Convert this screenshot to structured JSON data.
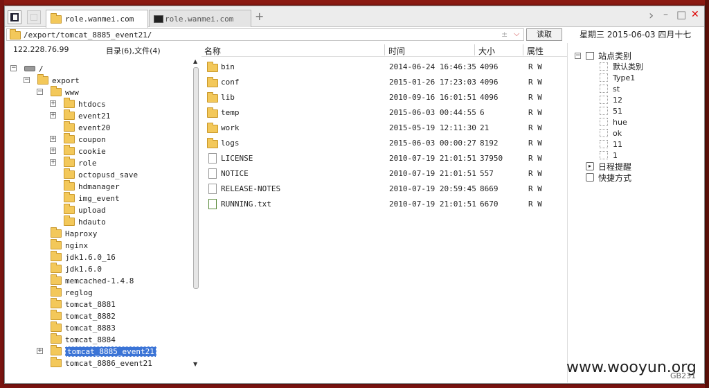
{
  "tabs": [
    {
      "label": "role.wanmei.com",
      "active": true
    },
    {
      "label": "role.wanmei.com",
      "active": false
    }
  ],
  "new_tab_label": "+",
  "window_controls": [
    "›",
    "–",
    "□",
    "✕"
  ],
  "address": {
    "path": "/export/tomcat_8885_event21/",
    "read_button": "读取"
  },
  "date_line": "星期三 2015-06-03 四月十七",
  "left_info": {
    "host": "122.228.76.99",
    "summary": "目录(6),文件(4)"
  },
  "tree": [
    {
      "label": "/",
      "level": 0,
      "exp": "-",
      "type": "drive"
    },
    {
      "label": "export",
      "level": 1,
      "exp": "-",
      "type": "folder"
    },
    {
      "label": "www",
      "level": 2,
      "exp": "-",
      "type": "folder"
    },
    {
      "label": "htdocs",
      "level": 3,
      "exp": "+",
      "type": "folder"
    },
    {
      "label": "event21",
      "level": 3,
      "exp": "+",
      "type": "folder"
    },
    {
      "label": "event20",
      "level": 3,
      "exp": "",
      "type": "folder"
    },
    {
      "label": "coupon",
      "level": 3,
      "exp": "+",
      "type": "folder"
    },
    {
      "label": "cookie",
      "level": 3,
      "exp": "+",
      "type": "folder"
    },
    {
      "label": "role",
      "level": 3,
      "exp": "+",
      "type": "folder"
    },
    {
      "label": "octopusd_save",
      "level": 3,
      "exp": "",
      "type": "folder"
    },
    {
      "label": "hdmanager",
      "level": 3,
      "exp": "",
      "type": "folder"
    },
    {
      "label": "img_event",
      "level": 3,
      "exp": "",
      "type": "folder"
    },
    {
      "label": "upload",
      "level": 3,
      "exp": "",
      "type": "folder"
    },
    {
      "label": "hdauto",
      "level": 3,
      "exp": "",
      "type": "folder"
    },
    {
      "label": "Haproxy",
      "level": 2,
      "exp": "",
      "type": "folder"
    },
    {
      "label": "nginx",
      "level": 2,
      "exp": "",
      "type": "folder"
    },
    {
      "label": "jdk1.6.0_16",
      "level": 2,
      "exp": "",
      "type": "folder"
    },
    {
      "label": "jdk1.6.0",
      "level": 2,
      "exp": "",
      "type": "folder"
    },
    {
      "label": "memcached-1.4.8",
      "level": 2,
      "exp": "",
      "type": "folder"
    },
    {
      "label": "reglog",
      "level": 2,
      "exp": "",
      "type": "folder"
    },
    {
      "label": "tomcat_8881",
      "level": 2,
      "exp": "",
      "type": "folder"
    },
    {
      "label": "tomcat_8882",
      "level": 2,
      "exp": "",
      "type": "folder"
    },
    {
      "label": "tomcat_8883",
      "level": 2,
      "exp": "",
      "type": "folder"
    },
    {
      "label": "tomcat_8884",
      "level": 2,
      "exp": "",
      "type": "folder"
    },
    {
      "label": "tomcat_8885_event21",
      "level": 2,
      "exp": "+",
      "type": "folder",
      "selected": true
    },
    {
      "label": "tomcat_8886_event21",
      "level": 2,
      "exp": "",
      "type": "folder"
    }
  ],
  "columns": [
    "名称",
    "时间",
    "大小",
    "属性"
  ],
  "files": [
    {
      "name": "bin",
      "time": "2014-06-24 16:46:35",
      "size": "4096",
      "attr": "R W",
      "type": "folder"
    },
    {
      "name": "conf",
      "time": "2015-01-26 17:23:03",
      "size": "4096",
      "attr": "R W",
      "type": "folder"
    },
    {
      "name": "lib",
      "time": "2010-09-16 16:01:51",
      "size": "4096",
      "attr": "R W",
      "type": "folder"
    },
    {
      "name": "temp",
      "time": "2015-06-03 00:44:55",
      "size": "6",
      "attr": "R W",
      "type": "folder"
    },
    {
      "name": "work",
      "time": "2015-05-19 12:11:30",
      "size": "21",
      "attr": "R W",
      "type": "folder"
    },
    {
      "name": "logs",
      "time": "2015-06-03 00:00:27",
      "size": "8192",
      "attr": "R W",
      "type": "folder"
    },
    {
      "name": "LICENSE",
      "time": "2010-07-19 21:01:51",
      "size": "37950",
      "attr": "R W",
      "type": "file"
    },
    {
      "name": "NOTICE",
      "time": "2010-07-19 21:01:51",
      "size": "557",
      "attr": "R W",
      "type": "file"
    },
    {
      "name": "RELEASE-NOTES",
      "time": "2010-07-19 20:59:45",
      "size": "8669",
      "attr": "R W",
      "type": "file"
    },
    {
      "name": "RUNNING.txt",
      "time": "2010-07-19 21:01:51",
      "size": "6670",
      "attr": "R W",
      "type": "txt"
    }
  ],
  "right_tree": {
    "root": "站点类别",
    "children": [
      "默认类别",
      "Type1",
      "st",
      "12",
      "51",
      "hue",
      "ok",
      "11",
      "1"
    ],
    "extra": [
      "日程提醒",
      "快捷方式"
    ]
  },
  "watermark": "www.wooyun.org",
  "bottom_code": "GB231"
}
